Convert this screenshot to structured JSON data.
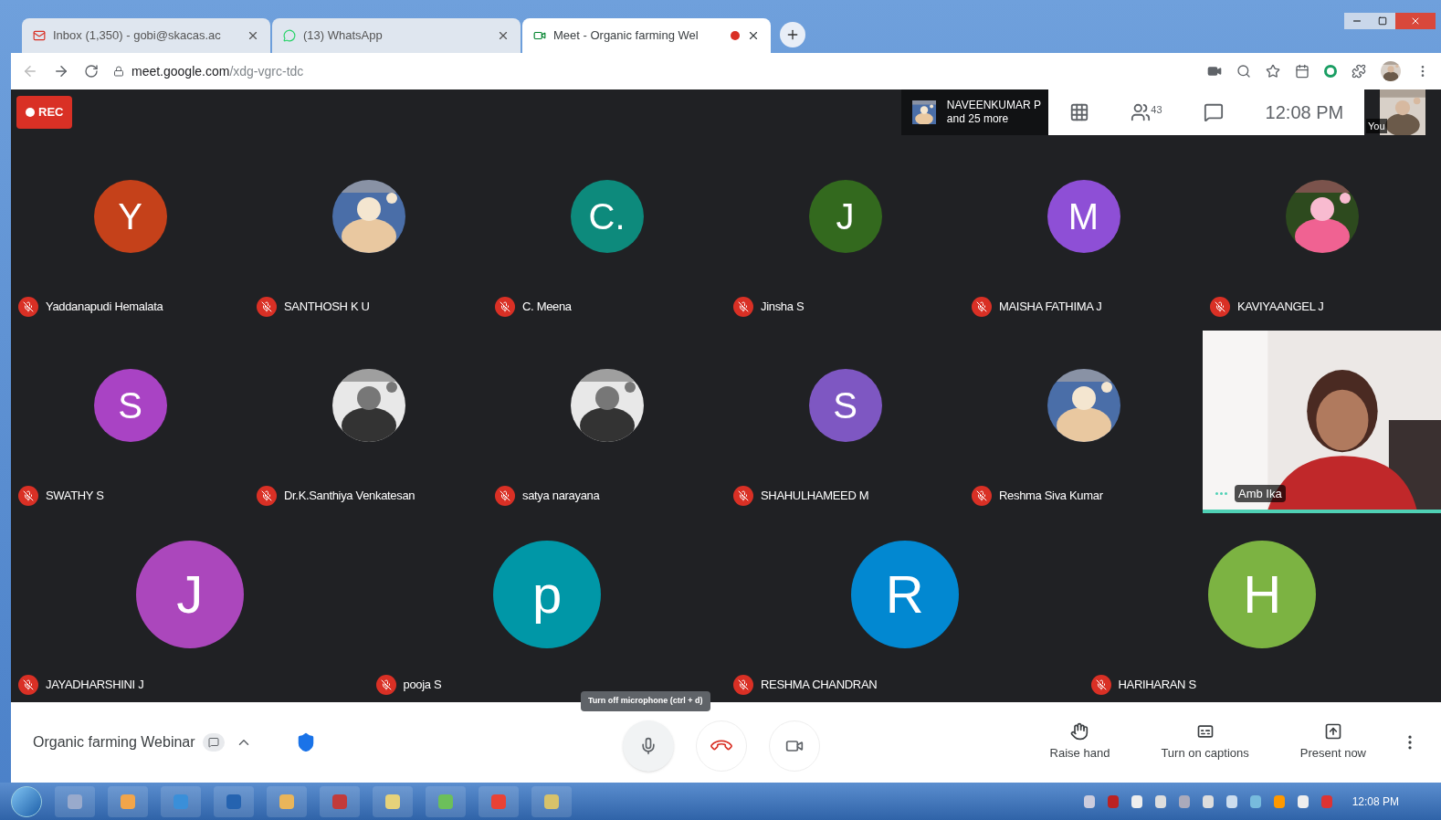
{
  "browser": {
    "tabs": [
      {
        "kind": "mail",
        "title": "Inbox (1,350) - gobi@skacas.ac",
        "selected": false
      },
      {
        "kind": "chat",
        "title": "(13) WhatsApp",
        "selected": false
      },
      {
        "kind": "meet",
        "title": "Meet - Organic farming Wel",
        "selected": true,
        "recording": true
      }
    ],
    "address": {
      "host": "meet.google.com",
      "path": "/xdg-vgrc-tdc"
    }
  },
  "meet": {
    "rec_label": "REC",
    "presenter": {
      "name": "NAVEENKUMAR P",
      "more": "and 25 more"
    },
    "participant_count": "43",
    "time": "12:08 PM",
    "self_label": "You",
    "strips": [
      {
        "tiles": [
          {
            "name": "Yaddanapudi Hemalata",
            "kind": "letter",
            "letter": "Y",
            "color": "#c5411a",
            "muted": true
          },
          {
            "name": "SANTHOSH K U",
            "kind": "picture",
            "muted": true
          },
          {
            "name": "C. Meena",
            "kind": "letter",
            "letter": "C.",
            "color": "#0d8a7c",
            "muted": true
          },
          {
            "name": "Jinsha S",
            "kind": "letter",
            "letter": "J",
            "color": "#33691e",
            "muted": true
          },
          {
            "name": "MAISHA FATHIMA J",
            "kind": "letter",
            "letter": "M",
            "color": "#8e4fd6",
            "muted": true
          },
          {
            "name": "KAVIYAANGEL J",
            "kind": "picture",
            "muted": true
          }
        ]
      },
      {
        "tiles": [
          {
            "name": "SWATHY S",
            "kind": "letter",
            "letter": "S",
            "color": "#a943c4",
            "muted": true
          },
          {
            "name": "Dr.K.Santhiya Venkatesan",
            "kind": "picture",
            "muted": true
          },
          {
            "name": "satya narayana",
            "kind": "picture",
            "muted": true
          },
          {
            "name": "SHAHULHAMEED M",
            "kind": "letter",
            "letter": "S",
            "color": "#7e57c2",
            "muted": true
          },
          {
            "name": "Reshma Siva Kumar",
            "kind": "picture",
            "muted": true
          },
          {
            "name": "Amb Ika",
            "kind": "video",
            "muted": false
          }
        ]
      },
      {
        "tiles": [
          {
            "name": "JAYADHARSHINI J",
            "kind": "letter",
            "letter": "J",
            "color": "#ab47bc",
            "muted": true
          },
          {
            "name": "pooja S",
            "kind": "letter",
            "letter": "p",
            "color": "#0097a7",
            "muted": true
          },
          {
            "name": "RESHMA CHANDRAN",
            "kind": "letter",
            "letter": "R",
            "color": "#0288d1",
            "muted": true
          },
          {
            "name": "HARIHARAN S",
            "kind": "letter",
            "letter": "H",
            "color": "#7cb342",
            "muted": true
          }
        ]
      }
    ],
    "meeting_name": "Organic farming Webinar",
    "tooltip": "Turn off microphone (ctrl + d)",
    "actions": [
      {
        "kind": "hand",
        "label": "Raise hand"
      },
      {
        "kind": "captions",
        "label": "Turn on captions"
      },
      {
        "kind": "present",
        "label": "Present now"
      }
    ]
  },
  "taskbar": {
    "clock": "12:08 PM"
  }
}
